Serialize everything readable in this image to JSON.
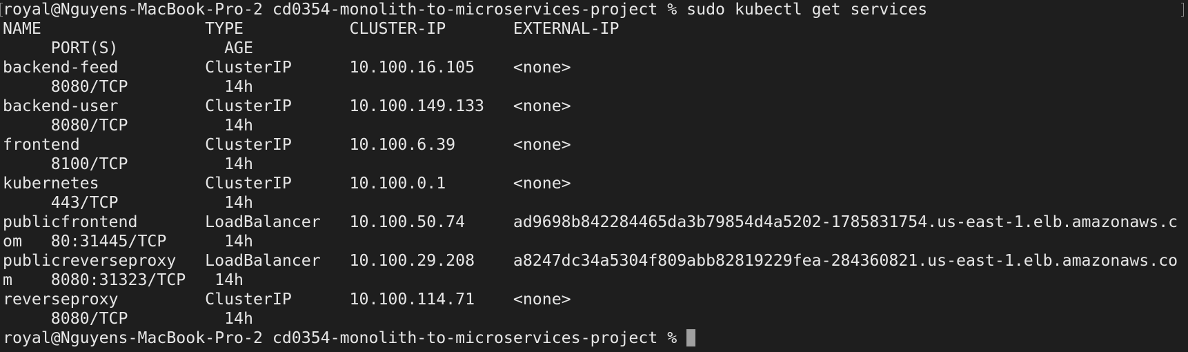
{
  "terminal": {
    "background": "#1e1e1e",
    "foreground": "#e6e6e6",
    "cursor_color": "#a0a0a0",
    "lines": [
      "royal@Nguyens-MacBook-Pro-2 cd0354-monolith-to-microservices-project % sudo kubectl get services",
      "NAME                 TYPE           CLUSTER-IP       EXTERNAL-IP",
      "     PORT(S)           AGE",
      "backend-feed         ClusterIP      10.100.16.105    <none>",
      "     8080/TCP          14h",
      "backend-user         ClusterIP      10.100.149.133   <none>",
      "     8080/TCP          14h",
      "frontend             ClusterIP      10.100.6.39      <none>",
      "     8100/TCP          14h",
      "kubernetes           ClusterIP      10.100.0.1       <none>",
      "     443/TCP           14h",
      "publicfrontend       LoadBalancer   10.100.50.74     ad9698b842284465da3b79854d4a5202-1785831754.us-east-1.elb.amazonaws.c",
      "om   80:31445/TCP      14h",
      "publicreverseproxy   LoadBalancer   10.100.29.208    a8247dc34a5304f809abb82819229fea-284360821.us-east-1.elb.amazonaws.co",
      "m    8080:31323/TCP   14h",
      "reverseproxy         ClusterIP      10.100.114.71    <none>",
      "     8080/TCP          14h"
    ],
    "prompt": "royal@Nguyens-MacBook-Pro-2 cd0354-monolith-to-microservices-project % "
  }
}
